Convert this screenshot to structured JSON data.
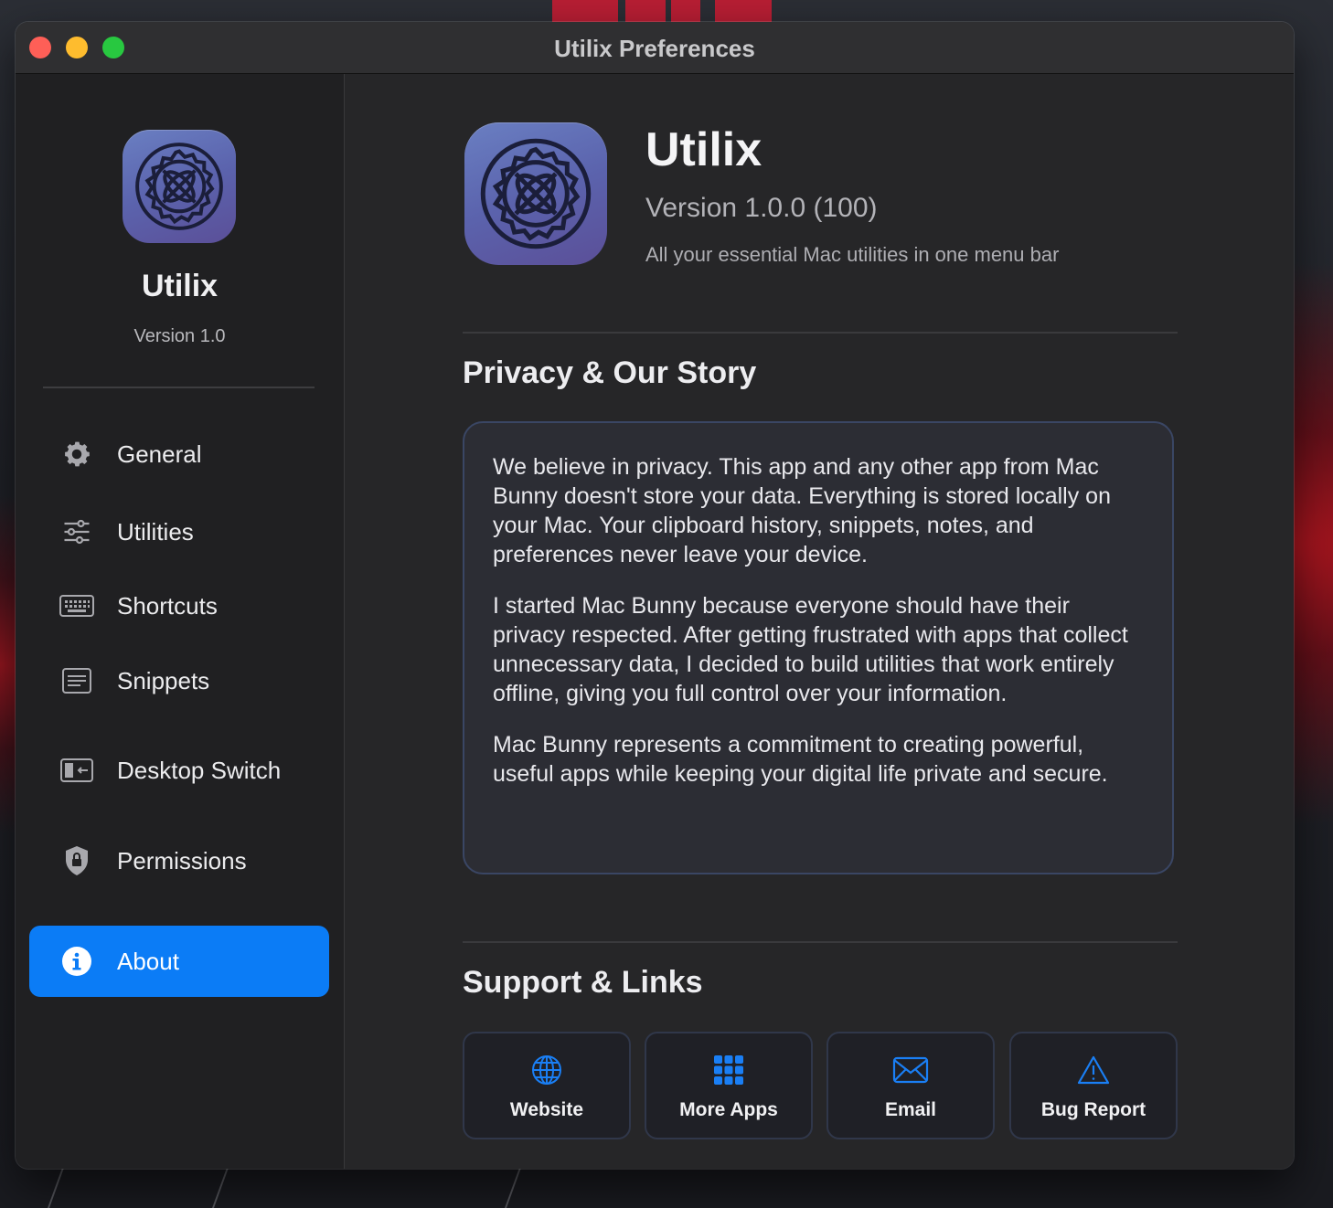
{
  "window": {
    "title": "Utilix Preferences"
  },
  "sidebar": {
    "app_name": "Utilix",
    "version": "Version 1.0",
    "items": [
      {
        "label": "General",
        "icon": "gear-icon"
      },
      {
        "label": "Utilities",
        "icon": "sliders-icon"
      },
      {
        "label": "Shortcuts",
        "icon": "keyboard-icon"
      },
      {
        "label": "Snippets",
        "icon": "text-document-icon"
      },
      {
        "label": "Desktop Switch",
        "icon": "desktop-switch-icon"
      },
      {
        "label": "Permissions",
        "icon": "shield-lock-icon"
      },
      {
        "label": "About",
        "icon": "info-icon",
        "active": true
      }
    ]
  },
  "about": {
    "app_name": "Utilix",
    "version": "Version 1.0.0 (100)",
    "tagline": "All your essential Mac utilities in one menu bar",
    "privacy_title": "Privacy & Our Story",
    "story": [
      "We believe in privacy. This app and any other app from Mac Bunny doesn't store your data. Everything is stored locally on your Mac. Your clipboard history, snippets, notes, and preferences never leave your device.",
      "I started Mac Bunny because everyone should have their privacy respected. After getting frustrated with apps that collect unnecessary data, I decided to build utilities that work entirely offline, giving you full control over your information.",
      "Mac Bunny represents a commitment to creating powerful, useful apps while keeping your digital life private and secure."
    ],
    "support_title": "Support & Links",
    "links": [
      {
        "label": "Website",
        "icon": "globe-icon"
      },
      {
        "label": "More Apps",
        "icon": "grid-icon"
      },
      {
        "label": "Email",
        "icon": "envelope-icon"
      },
      {
        "label": "Bug Report",
        "icon": "warning-icon"
      }
    ]
  },
  "colors": {
    "accent": "#0b7cf6",
    "link_icon": "#1a7ff5",
    "window_bg": "#262628",
    "sidebar_bg": "#202022"
  }
}
